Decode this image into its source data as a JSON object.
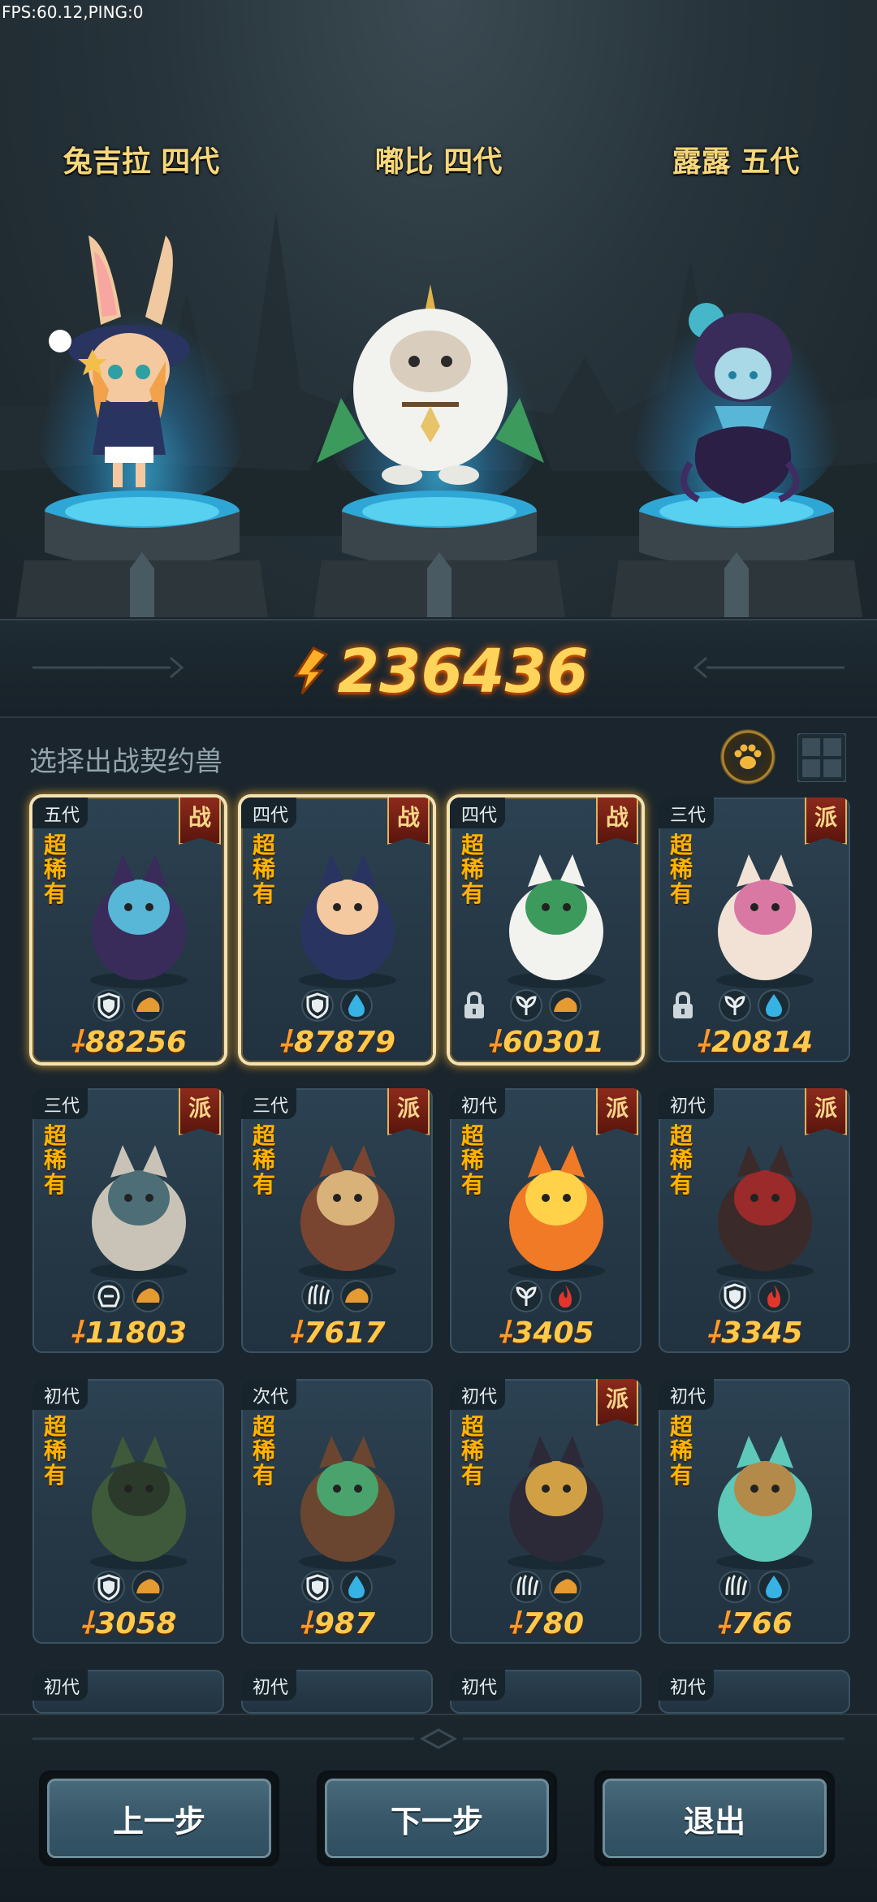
{
  "debug": {
    "fps_text": "FPS:60.12,PING:0"
  },
  "heroes": [
    {
      "name": "兔吉拉 四代"
    },
    {
      "name": "嘟比 四代"
    },
    {
      "name": "露露 五代"
    }
  ],
  "total_power": "236436",
  "selection": {
    "title": "选择出战契约兽",
    "paw_icon": "paw-icon",
    "grid_icon": "grid-view-icon"
  },
  "rarity_label": "超稀有",
  "cards": [
    {
      "gen": "五代",
      "badge": "战",
      "power": "88256",
      "selected": true,
      "locked": false,
      "icons": [
        "shield-icon",
        "earth-icon"
      ]
    },
    {
      "gen": "四代",
      "badge": "战",
      "power": "87879",
      "selected": true,
      "locked": false,
      "icons": [
        "shield-icon",
        "water-icon"
      ]
    },
    {
      "gen": "四代",
      "badge": "战",
      "power": "60301",
      "selected": true,
      "locked": true,
      "icons": [
        "leaf-icon",
        "earth-icon"
      ]
    },
    {
      "gen": "三代",
      "badge": "派",
      "power": "20814",
      "selected": false,
      "locked": true,
      "icons": [
        "leaf-icon",
        "water-icon"
      ]
    },
    {
      "gen": "三代",
      "badge": "派",
      "power": "11803",
      "selected": false,
      "locked": false,
      "icons": [
        "helmet-icon",
        "earth-icon"
      ]
    },
    {
      "gen": "三代",
      "badge": "派",
      "power": "7617",
      "selected": false,
      "locked": false,
      "icons": [
        "claw-icon",
        "earth-icon"
      ]
    },
    {
      "gen": "初代",
      "badge": "派",
      "power": "3405",
      "selected": false,
      "locked": false,
      "icons": [
        "leaf-icon",
        "fire-icon"
      ]
    },
    {
      "gen": "初代",
      "badge": "派",
      "power": "3345",
      "selected": false,
      "locked": false,
      "icons": [
        "shield-icon",
        "fire-icon"
      ]
    },
    {
      "gen": "初代",
      "badge": "",
      "power": "3058",
      "selected": false,
      "locked": false,
      "icons": [
        "shield-icon",
        "earth-icon"
      ]
    },
    {
      "gen": "次代",
      "badge": "",
      "power": "987",
      "selected": false,
      "locked": false,
      "icons": [
        "shield-icon",
        "water-icon"
      ]
    },
    {
      "gen": "初代",
      "badge": "派",
      "power": "780",
      "selected": false,
      "locked": false,
      "icons": [
        "claw-icon",
        "earth-icon"
      ]
    },
    {
      "gen": "初代",
      "badge": "",
      "power": "766",
      "selected": false,
      "locked": false,
      "icons": [
        "claw-icon",
        "water-icon"
      ]
    },
    {
      "gen": "初代"
    },
    {
      "gen": "初代"
    },
    {
      "gen": "初代"
    },
    {
      "gen": "初代"
    }
  ],
  "buttons": {
    "prev": "上一步",
    "next": "下一步",
    "exit": "退出"
  },
  "colors": {
    "gold": "#ffc94a",
    "badge_red": "#8c2a1c",
    "rarity_orange": "#ffb400",
    "button_blue": "#38586a"
  }
}
